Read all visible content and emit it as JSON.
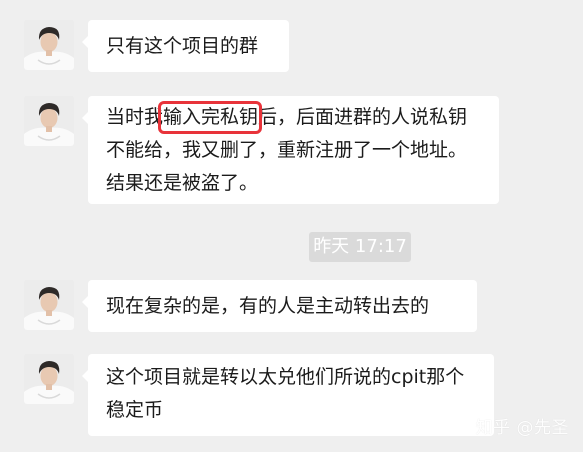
{
  "messages": [
    {
      "text": "只有这个项目的群"
    },
    {
      "text_before": "当时我",
      "highlight": "输入完私钥",
      "text_after": "后，后面进群的人说私钥不能给，我又删了，重新注册了一个地址。结果还是被盗了。"
    },
    {
      "text": "现在复杂的是，有的人是主动转出去的"
    },
    {
      "text": "这个项目就是转以太兑他们所说的cpit那个稳定币"
    }
  ],
  "timestamp": "昨天 17:17",
  "watermark": "知乎 @先圣",
  "colors": {
    "background": "#efefef",
    "bubble": "#ffffff",
    "highlight_border": "#e8333a",
    "timestamp_bg": "#dadada"
  },
  "icons": {
    "avatar": "person-photo-avatar"
  }
}
